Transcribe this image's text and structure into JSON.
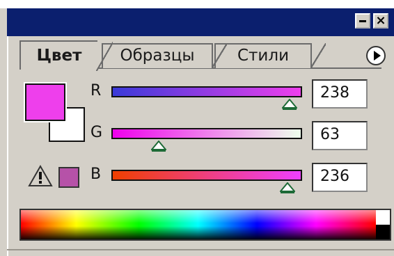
{
  "tabs": [
    {
      "label": "Цвет",
      "active": true
    },
    {
      "label": "Образцы",
      "active": false
    },
    {
      "label": "Стили",
      "active": false
    }
  ],
  "titlebar": {
    "minimize_icon": "minimize-icon",
    "close_label": "×"
  },
  "colors": {
    "foreground": "#ee3fec",
    "background": "#ffffff",
    "gamut_warning": "#b652a8",
    "titlebar": "#0b1f6e"
  },
  "channels": [
    {
      "name": "R",
      "value": "238",
      "fraction": 0.933,
      "gradient": [
        "#3a3ad8",
        "#ee3fec"
      ]
    },
    {
      "name": "G",
      "value": "63",
      "fraction": 0.247,
      "gradient": [
        "#ee00ec",
        "#eeffec"
      ]
    },
    {
      "name": "B",
      "value": "236",
      "fraction": 0.925,
      "gradient": [
        "#ee3f00",
        "#ee3fff"
      ]
    }
  ],
  "icons": {
    "warning": "warning-triangle-icon",
    "menu": "panel-menu-arrow-icon"
  }
}
